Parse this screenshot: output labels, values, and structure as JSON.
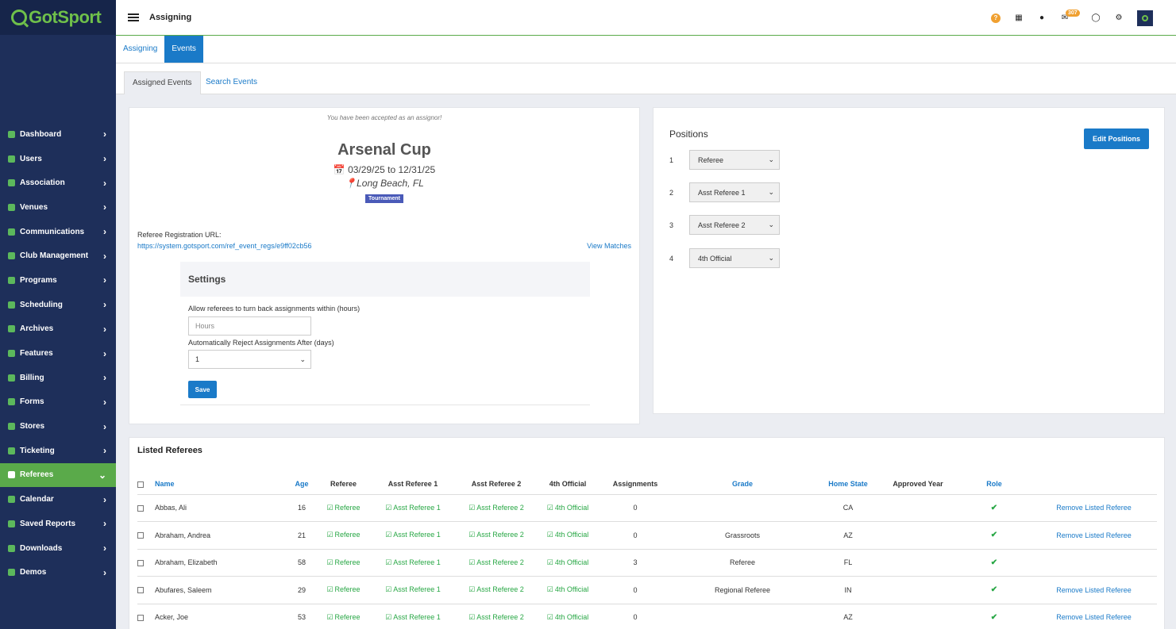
{
  "brand": {
    "name": "GotSport"
  },
  "sidebar": {
    "items": [
      {
        "label": "Dashboard"
      },
      {
        "label": "Users"
      },
      {
        "label": "Association"
      },
      {
        "label": "Venues"
      },
      {
        "label": "Communications"
      },
      {
        "label": "Club Management"
      },
      {
        "label": "Programs"
      },
      {
        "label": "Scheduling"
      },
      {
        "label": "Archives"
      },
      {
        "label": "Features"
      },
      {
        "label": "Billing"
      },
      {
        "label": "Forms"
      },
      {
        "label": "Stores"
      },
      {
        "label": "Ticketing"
      },
      {
        "label": "Referees",
        "active": true
      },
      {
        "label": "Calendar"
      },
      {
        "label": "Saved Reports"
      },
      {
        "label": "Downloads"
      },
      {
        "label": "Demos"
      }
    ]
  },
  "topbar": {
    "title": "Assigning",
    "mail_count": "307",
    "icons": [
      "help-icon",
      "grid-icon",
      "user-icon",
      "mail-icon",
      "chat-icon",
      "gear-icon",
      "account-icon"
    ]
  },
  "tabs": {
    "primary": [
      "Assigning",
      "Events"
    ],
    "secondary": [
      "Assigned Events",
      "Search Events"
    ]
  },
  "event": {
    "accepted_note": "You have been accepted as an assignor!",
    "title": "Arsenal Cup",
    "dates": "03/29/25 to 12/31/25",
    "location": "Long Beach, FL",
    "type": "Tournament",
    "reg_label": "Referee Registration URL:",
    "reg_url": "https://system.gotsport.com/ref_event_regs/e9ff02cb56",
    "view_matches": "View Matches"
  },
  "settings": {
    "title": "Settings",
    "turnback_label": "Allow referees to turn back assignments within (hours)",
    "turnback_placeholder": "Hours",
    "reject_label": "Automatically Reject Assignments After (days)",
    "reject_value": "1",
    "save_label": "Save"
  },
  "positions": {
    "title": "Positions",
    "edit_label": "Edit Positions",
    "items": [
      {
        "num": "1",
        "value": "Referee"
      },
      {
        "num": "2",
        "value": "Asst Referee 1"
      },
      {
        "num": "3",
        "value": "Asst Referee 2"
      },
      {
        "num": "4",
        "value": "4th Official"
      }
    ]
  },
  "referees": {
    "title": "Listed Referees",
    "columns": [
      "Name",
      "Age",
      "Referee",
      "Asst Referee 1",
      "Asst Referee 2",
      "4th Official",
      "Assignments",
      "Grade",
      "Home State",
      "Approved Year",
      "Role"
    ],
    "remove_label": "Remove Listed Referee",
    "rows": [
      {
        "name": "Abbas, Ali",
        "age": "16",
        "referee": "Referee",
        "ar1": "Asst Referee 1",
        "ar2": "Asst Referee 2",
        "fourth": "4th Official",
        "assignments": "0",
        "grade": "",
        "state": "CA",
        "approved": "",
        "remove": true
      },
      {
        "name": "Abraham, Andrea",
        "age": "21",
        "referee": "Referee",
        "ar1": "Asst Referee 1",
        "ar2": "Asst Referee 2",
        "fourth": "4th Official",
        "assignments": "0",
        "grade": "Grassroots",
        "state": "AZ",
        "approved": "",
        "remove": true
      },
      {
        "name": "Abraham, Elizabeth",
        "age": "58",
        "referee": "Referee",
        "ar1": "Asst Referee 1",
        "ar2": "Asst Referee 2",
        "fourth": "4th Official",
        "assignments": "3",
        "grade": "Referee",
        "state": "FL",
        "approved": "",
        "remove": false
      },
      {
        "name": "Abufares, Saleem",
        "age": "29",
        "referee": "Referee",
        "ar1": "Asst Referee 1",
        "ar2": "Asst Referee 2",
        "fourth": "4th Official",
        "assignments": "0",
        "grade": "Regional Referee",
        "state": "IN",
        "approved": "",
        "remove": true
      },
      {
        "name": "Acker, Joe",
        "age": "53",
        "referee": "Referee",
        "ar1": "Asst Referee 1",
        "ar2": "Asst Referee 2",
        "fourth": "4th Official",
        "assignments": "0",
        "grade": "",
        "state": "AZ",
        "approved": "",
        "remove": true
      }
    ]
  },
  "colors": {
    "sidebar": "#1e2f5a",
    "accent_green": "#5aaa4a",
    "link_blue": "#1a7ac8",
    "badge_orange": "#f0a030",
    "check_green": "#28a745"
  }
}
